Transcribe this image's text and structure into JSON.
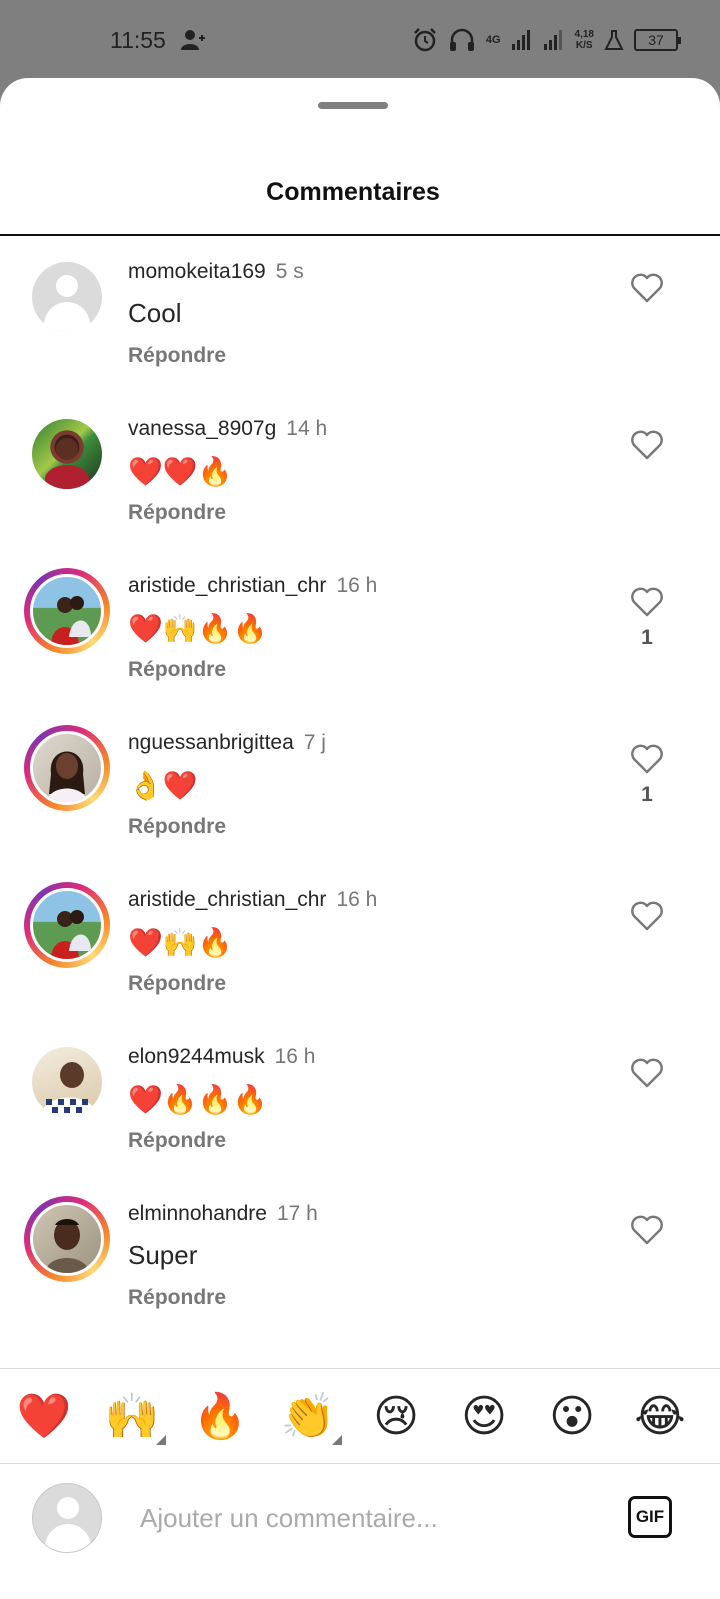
{
  "status_bar": {
    "time": "11:55",
    "network": "4G",
    "speed_top": "4,18",
    "speed_bottom": "K/S",
    "battery": "37"
  },
  "sheet": {
    "title": "Commentaires"
  },
  "comments": [
    {
      "username": "momokeita169",
      "time": "5 s",
      "text": "Cool",
      "reply": "Répondre",
      "likes": "",
      "avatar": "default",
      "ring": false
    },
    {
      "username": "vanessa_8907g",
      "time": "14 h",
      "text": "❤️❤️🔥",
      "reply": "Répondre",
      "likes": "",
      "avatar": "photo-green",
      "ring": false
    },
    {
      "username": "aristide_christian_chr",
      "time": "16 h",
      "text": "❤️🙌🔥🔥",
      "reply": "Répondre",
      "likes": "1",
      "avatar": "photo-couple",
      "ring": true
    },
    {
      "username": "nguessanbrigittea",
      "time": "7 j",
      "text": "👌❤️",
      "reply": "Répondre",
      "likes": "1",
      "avatar": "photo-woman",
      "ring": true
    },
    {
      "username": "aristide_christian_chr",
      "time": "16 h",
      "text": "❤️🙌🔥",
      "reply": "Répondre",
      "likes": "",
      "avatar": "photo-couple",
      "ring": true
    },
    {
      "username": "elon9244musk",
      "time": "16 h",
      "text": "❤️🔥🔥🔥",
      "reply": "Répondre",
      "likes": "",
      "avatar": "photo-man-plaid",
      "ring": false
    },
    {
      "username": "elminnohandre",
      "time": "17 h",
      "text": "Super",
      "reply": "Répondre",
      "likes": "",
      "avatar": "photo-man",
      "ring": true
    }
  ],
  "emoji_bar": [
    {
      "emoji": "❤️",
      "name": "red-heart",
      "has_variants": false
    },
    {
      "emoji": "🙌",
      "name": "raising-hands",
      "has_variants": true
    },
    {
      "emoji": "🔥",
      "name": "fire",
      "has_variants": false
    },
    {
      "emoji": "👏",
      "name": "clapping-hands",
      "has_variants": true
    },
    {
      "emoji": "😢",
      "name": "crying-face",
      "has_variants": false
    },
    {
      "emoji": "😍",
      "name": "heart-eyes",
      "has_variants": false
    },
    {
      "emoji": "😮",
      "name": "surprised-face",
      "has_variants": false
    },
    {
      "emoji": "😂",
      "name": "laughing-face",
      "has_variants": false
    }
  ],
  "input": {
    "placeholder": "Ajouter un commentaire...",
    "value": "",
    "gif_label": "GIF"
  },
  "colors": {
    "ring_start": "#f58529",
    "ring_end": "#dd2a7b",
    "heart": "#e0211b",
    "fire": "#ff7a00"
  }
}
